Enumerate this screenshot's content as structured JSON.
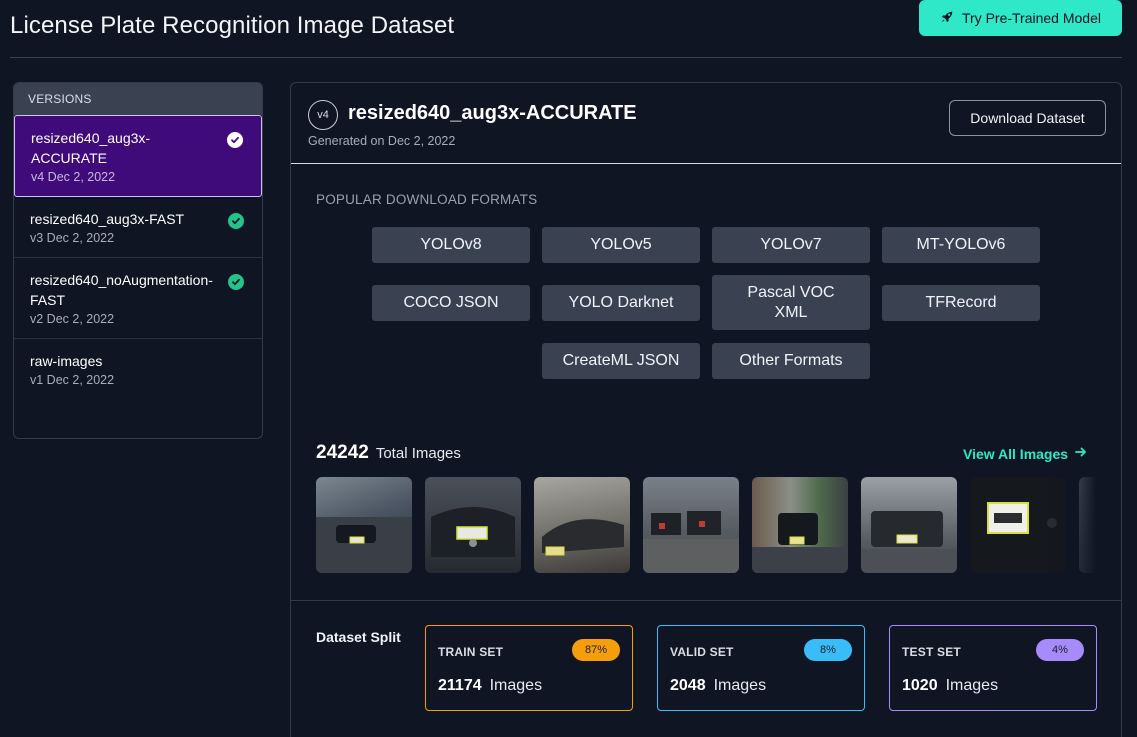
{
  "page": {
    "title": "License Plate Recognition Image Dataset",
    "try_model_label": "Try Pre-Trained Model"
  },
  "colors": {
    "accent": "#2ee8c7",
    "active_version": "#3f0a7a",
    "check_green": "#22c48a",
    "train": "#f59e0b",
    "valid": "#38bdf8",
    "test": "#a78bfa"
  },
  "versions": {
    "header": "VERSIONS",
    "items": [
      {
        "name": "resized640_aug3x-ACCURATE",
        "meta": "v4 Dec 2, 2022",
        "icon": "check-circle-icon"
      },
      {
        "name": "resized640_aug3x-FAST",
        "meta": "v3 Dec 2, 2022",
        "icon": "check-circle-icon"
      },
      {
        "name": "resized640_noAugmentation-FAST",
        "meta": "v2 Dec 2, 2022",
        "icon": "check-circle-icon"
      },
      {
        "name": "raw-images",
        "meta": "v1 Dec 2, 2022"
      }
    ]
  },
  "main": {
    "badge": "v4",
    "title": "resized640_aug3x-ACCURATE",
    "subtitle": "Generated on Dec 2, 2022",
    "download_label": "Download Dataset",
    "formats_label": "POPULAR DOWNLOAD FORMATS",
    "formats": [
      "YOLOv8",
      "YOLOv5",
      "YOLOv7",
      "MT-YOLOv6",
      "COCO JSON",
      "YOLO Darknet",
      "Pascal VOC XML",
      "TFRecord",
      "CreateML JSON",
      "Other Formats"
    ],
    "images_count": "24242",
    "images_label": "Total Images",
    "view_all_label": "View All Images",
    "split_label": "Dataset Split",
    "splits": [
      {
        "name": "TRAIN SET",
        "percent": "87%",
        "count": "21174",
        "unit": "Images"
      },
      {
        "name": "VALID SET",
        "percent": "8%",
        "count": "2048",
        "unit": "Images"
      },
      {
        "name": "TEST SET",
        "percent": "4%",
        "count": "1020",
        "unit": "Images"
      }
    ]
  }
}
